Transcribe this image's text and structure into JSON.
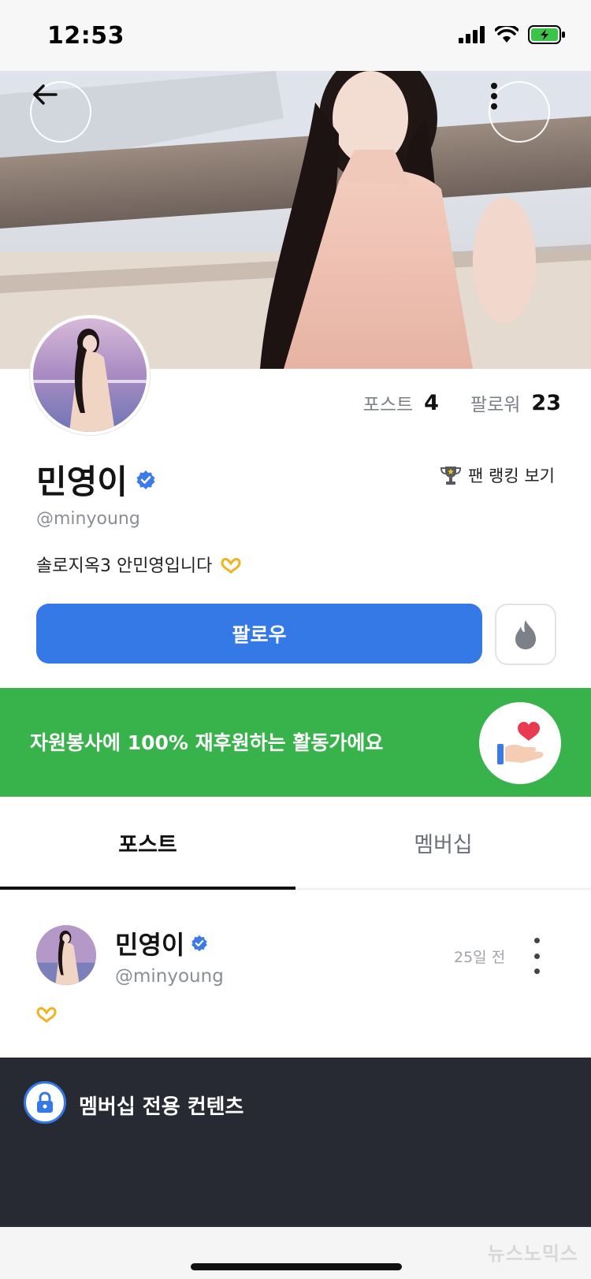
{
  "status_bar": {
    "time": "12:53"
  },
  "profile": {
    "name": "민영이",
    "handle": "@minyoung",
    "bio": "솔로지옥3 안민영입니다",
    "stats": [
      {
        "label": "포스트",
        "value": "4"
      },
      {
        "label": "팔로워",
        "value": "23"
      }
    ],
    "fan_ranking_label": "팬 랭킹 보기",
    "follow_label": "팔로우"
  },
  "banner": {
    "text": "자원봉사에 100% 재후원하는 활동가에요"
  },
  "tabs": [
    {
      "label": "포스트",
      "active": true
    },
    {
      "label": "멤버십",
      "active": false
    }
  ],
  "post": {
    "author_name": "민영이",
    "author_handle": "@minyoung",
    "time_ago": "25일 전",
    "locked_label": "멤버십 전용 컨텐츠"
  },
  "footer": {
    "watermark": "뉴스노믹스"
  },
  "colors": {
    "accent": "#3479e6",
    "banner": "#38b24a",
    "locked_bg": "#272a33",
    "verified": "#3b7ae8",
    "heart": "#e83b52"
  },
  "icons": [
    "back-arrow-icon",
    "more-vertical-icon",
    "verified-badge-icon",
    "trophy-icon",
    "fire-icon",
    "heart-hand-icon",
    "lock-icon",
    "heart-hands-emoji-icon"
  ]
}
